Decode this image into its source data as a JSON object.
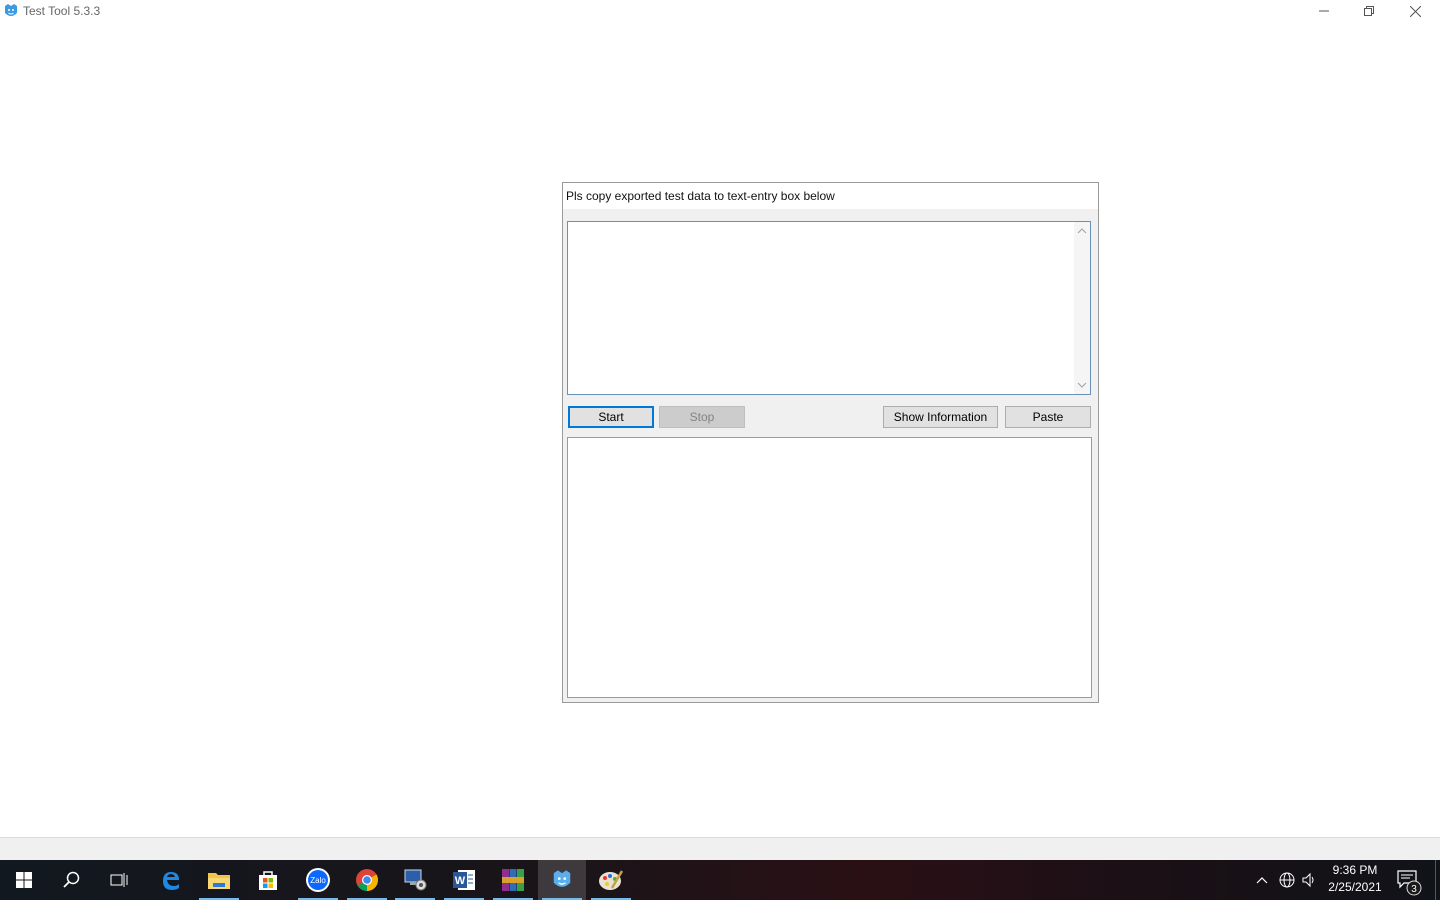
{
  "window": {
    "title": "Test Tool 5.3.3",
    "icon": "app-face-icon",
    "controls": [
      "minimize-icon",
      "restore-icon",
      "close-icon"
    ]
  },
  "panel": {
    "instruction": "Pls copy exported test data to text-entry box below",
    "input_value": "",
    "output_value": "",
    "buttons": {
      "start": "Start",
      "stop": "Stop",
      "show_info": "Show Information",
      "paste": "Paste"
    }
  },
  "taskbar": {
    "items": [
      {
        "name": "start-icon"
      },
      {
        "name": "search-icon"
      },
      {
        "name": "task-view-icon"
      },
      {
        "name": "edge-icon"
      },
      {
        "name": "file-explorer-icon",
        "running": true
      },
      {
        "name": "store-icon"
      },
      {
        "name": "zalo-icon",
        "running": true
      },
      {
        "name": "chrome-icon",
        "running": true
      },
      {
        "name": "remote-tool-icon",
        "running": true
      },
      {
        "name": "word-icon",
        "running": true
      },
      {
        "name": "winrar-icon",
        "running": true
      },
      {
        "name": "test-tool-icon",
        "running": true,
        "active": true
      },
      {
        "name": "paint-icon",
        "running": true
      }
    ],
    "clock": {
      "time": "9:36 PM",
      "date": "2/25/2021"
    },
    "notification_count": "3",
    "colors": {
      "accent": "#0078d7",
      "running_indicator": "#76b9ed"
    }
  }
}
